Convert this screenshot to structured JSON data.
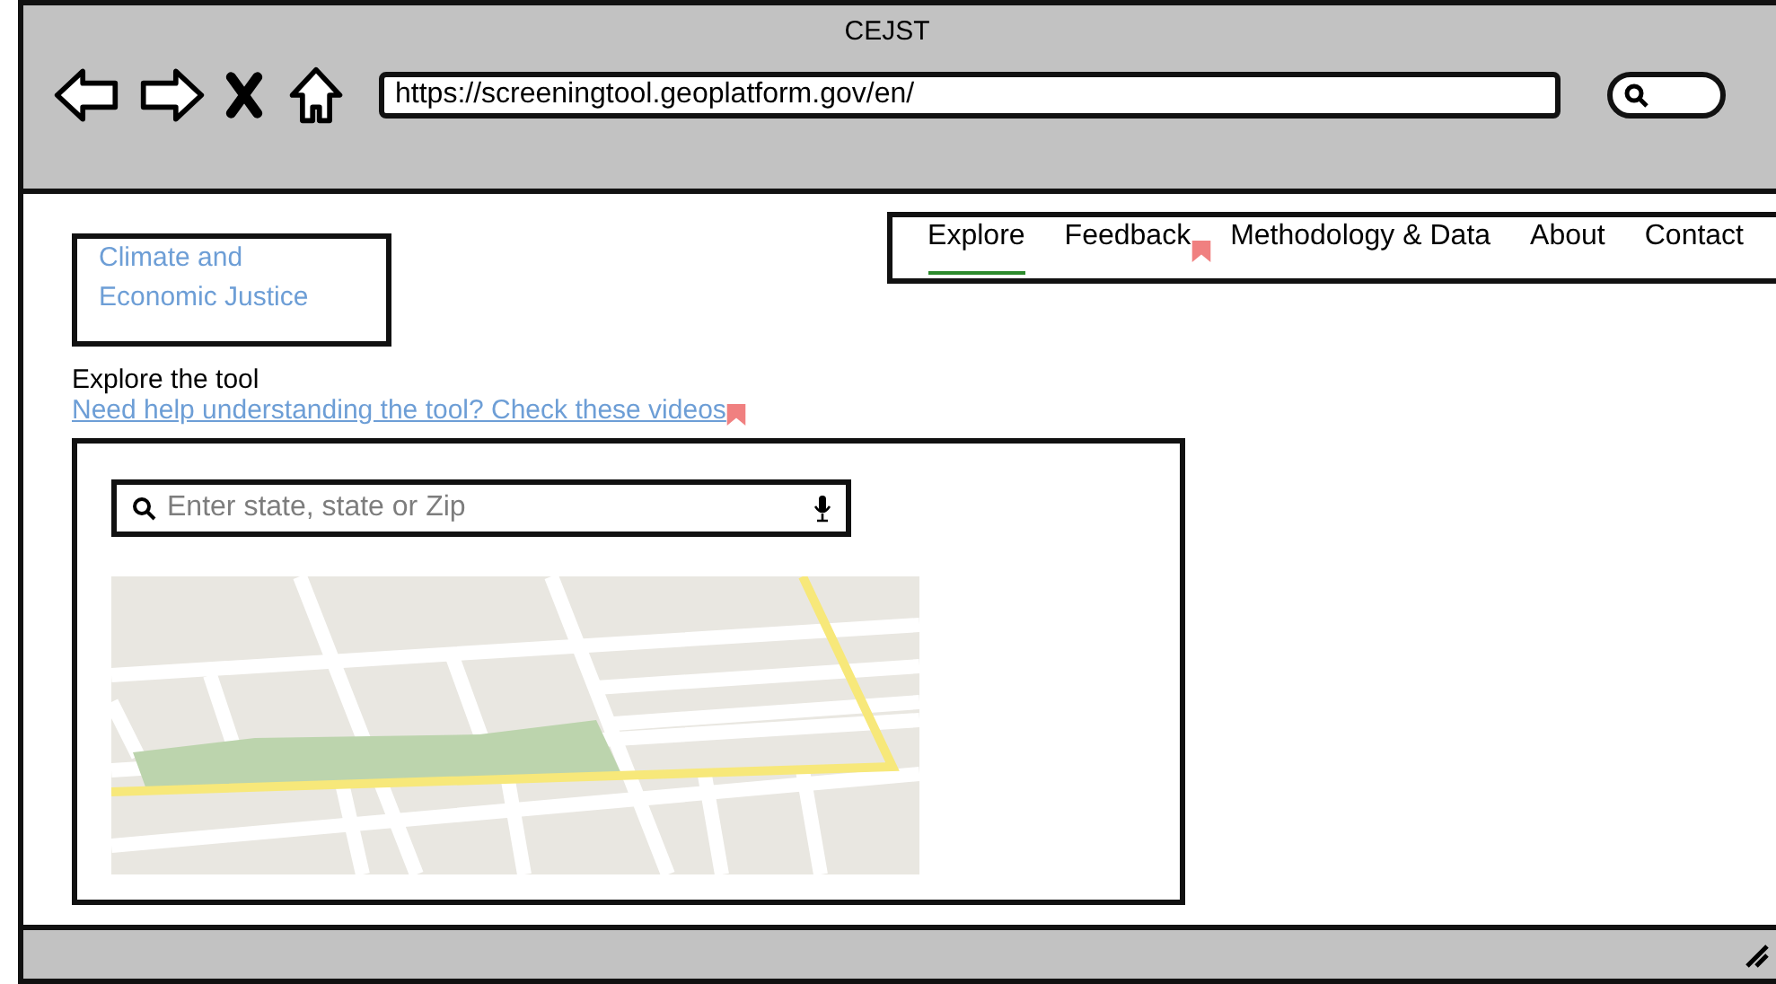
{
  "window": {
    "title": "CEJST"
  },
  "browser": {
    "url": "https://screeningtool.geoplatform.gov/en/"
  },
  "logo": {
    "lines": [
      "Climate and",
      "Economic Justice"
    ]
  },
  "nav": [
    {
      "label": "Explore",
      "selected": true,
      "comment": false
    },
    {
      "label": "Feedback",
      "selected": false,
      "comment": true
    },
    {
      "label": "Methodology & Data",
      "selected": false,
      "comment": false
    },
    {
      "label": "About",
      "selected": false,
      "comment": false
    },
    {
      "label": "Contact",
      "selected": false,
      "comment": false
    }
  ],
  "intro": {
    "heading": "Explore the tool",
    "link": "Need help understanding the tool? Check these videos"
  },
  "search": {
    "placeholder": "Enter state, state or Zip"
  }
}
